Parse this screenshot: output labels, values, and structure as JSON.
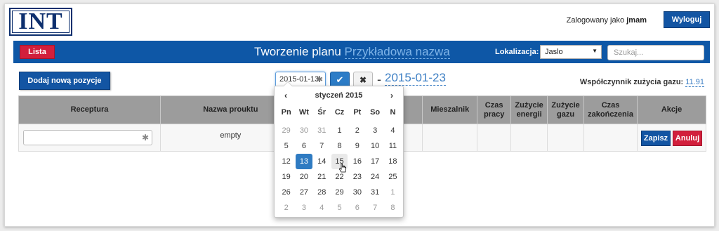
{
  "header": {
    "logo_text": "INT",
    "logged_in_label": "Zalogowany jako",
    "username": "jmam",
    "logout_label": "Wyloguj"
  },
  "toolbar": {
    "lista_label": "Lista",
    "title": "Tworzenie planu",
    "plan_name": "Przykładowa nazwa",
    "location_label": "Lokalizacja:",
    "location_value": "Jaslo",
    "search_placeholder": "Szukaj..."
  },
  "actions": {
    "add_label": "Dodaj nową pozycje",
    "date_from": "2015-01-13",
    "dash": "-",
    "date_to": "2015-01-23",
    "coef_label": "Współczynnik zużycia gazu:",
    "coef_value": "11.91"
  },
  "table": {
    "headers": {
      "receptura": "Receptura",
      "nazwa": "Nazwa prouktu",
      "mieszalnik": "Mieszalnik",
      "czas_pracy_1": "Czas",
      "czas_pracy_2": "pracy",
      "zuzycie_energii_1": "Zużycie",
      "zuzycie_energii_2": "energii",
      "zuzycie_gazu_1": "Zużycie",
      "zuzycie_gazu_2": "gazu",
      "czas_zak_1": "Czas",
      "czas_zak_2": "zakończenia",
      "akcje": "Akcje"
    },
    "row": {
      "product": "empty",
      "save_label": "Zapisz",
      "cancel_label": "Anuluj"
    }
  },
  "datepicker": {
    "prev": "‹",
    "next": "›",
    "month": "styczeń 2015",
    "weekdays": [
      "Pn",
      "Wt",
      "Śr",
      "Cz",
      "Pt",
      "So",
      "N"
    ],
    "weeks": [
      [
        "29",
        "30",
        "31",
        "1",
        "2",
        "3",
        "4"
      ],
      [
        "5",
        "6",
        "7",
        "8",
        "9",
        "10",
        "11"
      ],
      [
        "12",
        "13",
        "14",
        "15",
        "16",
        "17",
        "18"
      ],
      [
        "19",
        "20",
        "21",
        "22",
        "23",
        "24",
        "25"
      ],
      [
        "26",
        "27",
        "28",
        "29",
        "30",
        "31",
        "1"
      ],
      [
        "2",
        "3",
        "4",
        "5",
        "6",
        "7",
        "8"
      ]
    ],
    "selected_day": "13",
    "hover_day": "15"
  },
  "colors": {
    "brand_blue": "#0e57a6",
    "button_blue": "#1355a3",
    "danger_red": "#d21f3c",
    "link_blue": "#3d7fc4"
  }
}
